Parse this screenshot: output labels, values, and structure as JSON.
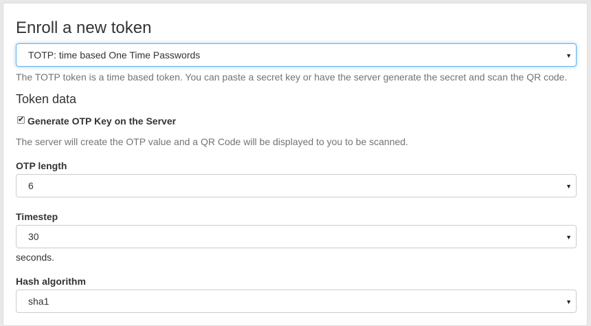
{
  "page": {
    "title": "Enroll a new token",
    "token_type": {
      "selected": "TOTP: time based One Time Passwords"
    },
    "token_description": "The TOTP token is a time based token. You can paste a secret key or have the server generate the secret and scan the QR code.",
    "token_data_heading": "Token data",
    "generate_key": {
      "checked": true,
      "label": "Generate OTP Key on the Server",
      "help": "The server will create the OTP value and a QR Code will be displayed to you to be scanned."
    },
    "otp_length": {
      "label": "OTP length",
      "selected": "6"
    },
    "timestep": {
      "label": "Timestep",
      "selected": "30",
      "unit": "seconds."
    },
    "hash_algorithm": {
      "label": "Hash algorithm",
      "selected": "sha1"
    }
  },
  "icons": {
    "dropdown_caret": "caret-down-icon",
    "checkmark": "check-icon"
  },
  "colors": {
    "focus_border": "#66afe9",
    "help_text": "#737373",
    "text": "#333333"
  }
}
